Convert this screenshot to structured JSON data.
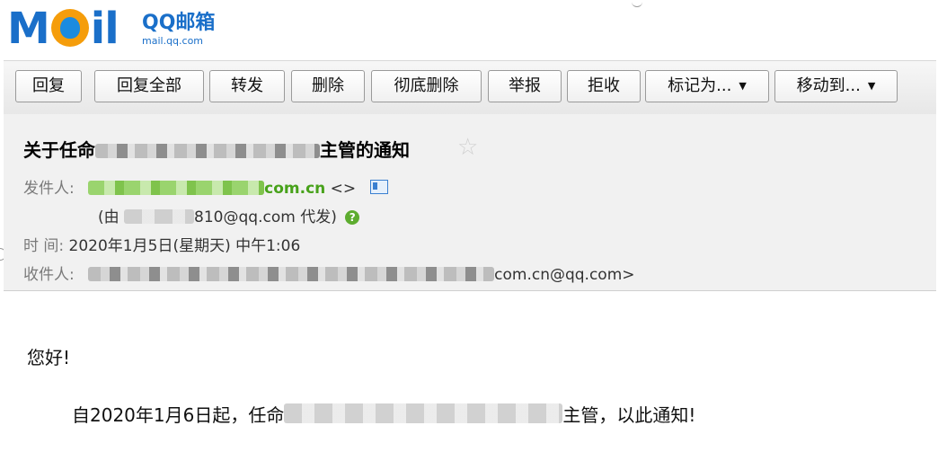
{
  "logo": {
    "cn_name": "QQ邮箱",
    "domain": "mail.qq.com",
    "mark": "MAIL"
  },
  "toolbar": {
    "buttons": [
      {
        "label": "回复"
      },
      {
        "label": "回复全部"
      },
      {
        "label": "转发"
      },
      {
        "label": "删除"
      },
      {
        "label": "彻底删除"
      },
      {
        "label": "举报"
      },
      {
        "label": "拒收"
      },
      {
        "label": "标记为..."
      },
      {
        "label": "移动到..."
      }
    ]
  },
  "email": {
    "subject_prefix": "关于任命",
    "subject_suffix": "主管的通知",
    "sender_label": "发件人:",
    "sender_domain": "com.cn",
    "sender_brackets": "<>",
    "proxy_prefix": "(由",
    "proxy_suffix": "810@qq.com 代发)",
    "time_label": "时  间:",
    "time_value": "2020年1月5日(星期天) 中午1:06",
    "recipient_label": "收件人:",
    "recipient_suffix": "com.cn@qq.com>"
  },
  "content": {
    "greeting": "您好!",
    "line_prefix": "自2020年1月6日起，任命",
    "line_suffix": "主管，以此通知!"
  },
  "colors": {
    "toolbar_bg": "#ececec",
    "header_bg": "#f1f1f1",
    "sender_green": "#48a21b",
    "logo_blue": "#1a6fc9"
  }
}
